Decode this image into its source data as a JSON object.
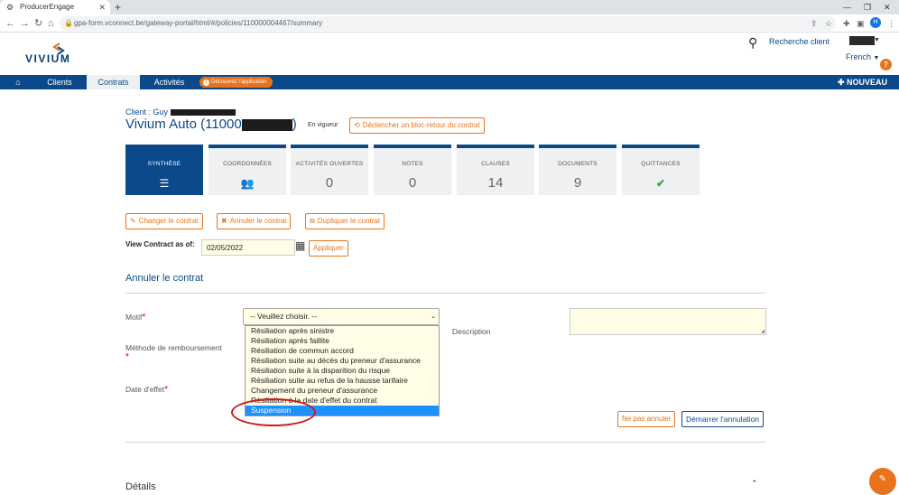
{
  "browser": {
    "tab_title": "ProducerEngage",
    "url": "gpa-form.vconnect.be/gateway-portal/html/#/policies/110000004467/summary",
    "profile_initial": "H"
  },
  "header": {
    "logo_text": "VIVIUM",
    "search_label": "Recherche client",
    "language": "French",
    "help_badge": "?"
  },
  "mainnav": {
    "items": [
      {
        "label": "Clients"
      },
      {
        "label": "Contrats"
      },
      {
        "label": "Activités"
      }
    ],
    "discover_label": "Découvrez l'application",
    "new_label": "NOUVEAU"
  },
  "contract": {
    "client_label": "Client : Guy",
    "title": "Vivium Auto (11000",
    "title_end": ")",
    "status": "En vigueur",
    "trigger_button": "Déclencher un bloc-retour du contrat"
  },
  "tiles": [
    {
      "label": "SYNTHÈSE",
      "value": "",
      "icon": "menu-icon"
    },
    {
      "label": "COORDONNÉES",
      "value": "",
      "icon": "users-icon"
    },
    {
      "label": "ACTIVITÉS OUVERTES",
      "value": "0"
    },
    {
      "label": "NOTES",
      "value": "0"
    },
    {
      "label": "CLAUSES",
      "value": "14"
    },
    {
      "label": "DOCUMENTS",
      "value": "9"
    },
    {
      "label": "QUITTANCES",
      "value": "",
      "icon": "check-icon"
    }
  ],
  "actions": {
    "change": "Changer le contrat",
    "cancel": "Annuler le contrat",
    "duplicate": "Dupliquer le contrat",
    "view_as_of_label": "View Contract as of:",
    "date_value": "02/05/2022",
    "apply": "Appliquer"
  },
  "form": {
    "section_title": "Annuler le contrat",
    "motif_label": "Motif",
    "refund_label": "Méthode de remboursement",
    "effective_date_label": "Date d'effet",
    "description_label": "Description",
    "required_mark": "*",
    "select_value": "-- Veuillez choisir. --",
    "options": [
      "Résiliation après sinistre",
      "Résiliation après faillite",
      "Résiliation de commun accord",
      "Résiliation suite au décès du preneur d'assurance",
      "Résiliation suite à la disparition du risque",
      "Résiliation suite au refus de la hausse tarifaire",
      "Changement du preneur d'assurance",
      "Résiliation à la date d'effet du contrat",
      "Suspension"
    ],
    "selected_index": 8,
    "no_cancel_button": "Ne pas annuler",
    "start_cancel_button": "Démarrer l'annulation"
  },
  "bottom": {
    "section_title": "Détails"
  },
  "colors": {
    "brand_blue": "#0b4a8a",
    "accent_orange": "#e8731c",
    "highlight_red": "#cc1a1a"
  }
}
